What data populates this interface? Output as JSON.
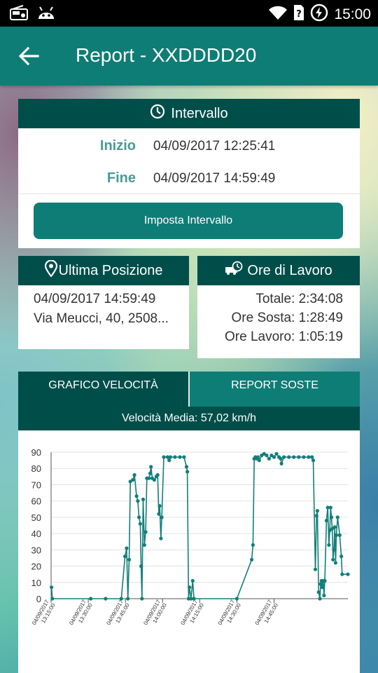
{
  "status_bar": {
    "time": "15:00",
    "icons": [
      "radio-icon",
      "android-icon",
      "wifi-icon",
      "sim-unknown-icon",
      "battery-charging-icon"
    ]
  },
  "app_bar": {
    "title": "Report - XXDDDD20",
    "back_icon": "arrow-back-icon"
  },
  "interval": {
    "header": "Intervallo",
    "header_icon": "clock-icon",
    "start_label": "Inizio",
    "start_value": "04/09/2017 12:25:41",
    "end_label": "Fine",
    "end_value": "04/09/2017 14:59:49",
    "button_label": "Imposta Intervallo"
  },
  "last_position": {
    "header": "Ultima Posizione",
    "header_icon": "map-pin-icon",
    "timestamp": "04/09/2017 14:59:49",
    "address": "Via Meucci, 40, 2508..."
  },
  "work_hours": {
    "header": "Ore di Lavoro",
    "header_icon": "truck-clock-icon",
    "total": "Totale: 2:34:08",
    "stop_hours": "Ore Sosta: 1:28:49",
    "work_hours": "Ore Lavoro: 1:05:19"
  },
  "tabs": [
    {
      "label": "GRAFICO VELOCITÀ",
      "active": true
    },
    {
      "label": "REPORT SOSTE",
      "active": false
    }
  ],
  "speed_summary": "Velocità Media: 57,02 km/h",
  "colors": {
    "primary": "#0e7d75",
    "primary_dark": "#004e4a",
    "label_teal": "#4a9a96",
    "line": "#137f79"
  },
  "chart_data": {
    "type": "line",
    "title": "",
    "xlabel": "",
    "ylabel": "",
    "ylim": [
      0,
      90
    ],
    "yticks": [
      0,
      10,
      20,
      30,
      40,
      50,
      60,
      70,
      80,
      90
    ],
    "xlim": [
      "13:00:00",
      "14:59:49"
    ],
    "xticks": [
      {
        "t": "13:00:00",
        "label": "04/09/2017 13:15:00"
      },
      {
        "t": "13:15:00",
        "label": "04/09/2017 13:30:00"
      },
      {
        "t": "13:30:00",
        "label": "04/09/2017 13:45:00"
      },
      {
        "t": "13:45:00",
        "label": "04/09/2017 14:00:00"
      },
      {
        "t": "14:00:00",
        "label": "04/09/2017 14:15:00"
      },
      {
        "t": "14:15:00",
        "label": "04/09/2017 14:30:00"
      },
      {
        "t": "14:30:00",
        "label": "04/09/2017 14:45:00"
      }
    ],
    "grid": true,
    "series": [
      {
        "points": [
          [
            "13:00:10",
            7
          ],
          [
            "13:00:30",
            0
          ],
          [
            "13:16:00",
            0
          ],
          [
            "13:22:00",
            0
          ],
          [
            "13:28:20",
            0
          ],
          [
            "13:29:50",
            26
          ],
          [
            "13:30:30",
            31
          ],
          [
            "13:31:00",
            0
          ],
          [
            "13:31:30",
            24
          ],
          [
            "13:32:00",
            72
          ],
          [
            "13:33:00",
            73
          ],
          [
            "13:33:40",
            76
          ],
          [
            "13:34:30",
            63
          ],
          [
            "13:35:00",
            60
          ],
          [
            "13:35:30",
            50
          ],
          [
            "13:36:00",
            46
          ],
          [
            "13:36:20",
            20
          ],
          [
            "13:36:40",
            0
          ],
          [
            "13:37:10",
            61
          ],
          [
            "13:37:40",
            33
          ],
          [
            "13:38:10",
            41
          ],
          [
            "13:38:40",
            74
          ],
          [
            "13:39:30",
            74
          ],
          [
            "13:40:00",
            77
          ],
          [
            "13:40:20",
            81
          ],
          [
            "13:40:50",
            74
          ],
          [
            "13:41:40",
            73
          ],
          [
            "13:42:30",
            75
          ],
          [
            "13:43:00",
            76
          ],
          [
            "13:43:30",
            52
          ],
          [
            "13:43:50",
            57
          ],
          [
            "13:44:20",
            37
          ],
          [
            "13:44:40",
            50
          ],
          [
            "13:45:30",
            87
          ],
          [
            "13:47:00",
            87
          ],
          [
            "13:47:40",
            85
          ],
          [
            "13:48:10",
            87
          ],
          [
            "13:50:00",
            87
          ],
          [
            "13:52:00",
            87
          ],
          [
            "13:53:40",
            87
          ],
          [
            "13:54:40",
            81
          ],
          [
            "13:55:00",
            78
          ],
          [
            "13:55:30",
            0
          ],
          [
            "13:55:50",
            7
          ],
          [
            "13:56:30",
            0
          ],
          [
            "13:57:10",
            11
          ],
          [
            "13:57:40",
            0
          ],
          [
            "14:15:00",
            0
          ],
          [
            "14:21:00",
            24
          ],
          [
            "14:21:30",
            33
          ],
          [
            "14:22:00",
            86
          ],
          [
            "14:22:30",
            87
          ],
          [
            "14:23:00",
            86
          ],
          [
            "14:23:30",
            87
          ],
          [
            "14:24:00",
            85
          ],
          [
            "14:25:00",
            88
          ],
          [
            "14:26:00",
            89
          ],
          [
            "14:27:00",
            88
          ],
          [
            "14:28:00",
            86
          ],
          [
            "14:29:00",
            88
          ],
          [
            "14:30:00",
            87
          ],
          [
            "14:31:00",
            89
          ],
          [
            "14:32:00",
            87
          ],
          [
            "14:32:40",
            86
          ],
          [
            "14:33:00",
            83
          ],
          [
            "14:34:00",
            87
          ],
          [
            "14:36:00",
            87
          ],
          [
            "14:38:00",
            87
          ],
          [
            "14:40:00",
            87
          ],
          [
            "14:42:00",
            87
          ],
          [
            "14:44:00",
            87
          ],
          [
            "14:45:20",
            87
          ],
          [
            "14:45:50",
            85
          ],
          [
            "14:46:40",
            18
          ],
          [
            "14:47:10",
            51
          ],
          [
            "14:47:30",
            54
          ],
          [
            "14:48:00",
            4
          ],
          [
            "14:48:30",
            0
          ],
          [
            "14:48:50",
            9
          ],
          [
            "14:49:10",
            11
          ],
          [
            "14:49:30",
            7
          ],
          [
            "14:49:50",
            11
          ],
          [
            "14:50:10",
            2
          ],
          [
            "14:50:30",
            11
          ],
          [
            "14:51:10",
            48
          ],
          [
            "14:51:40",
            56
          ],
          [
            "14:52:10",
            33
          ],
          [
            "14:52:30",
            42
          ],
          [
            "14:52:50",
            56
          ],
          [
            "14:53:10",
            50
          ],
          [
            "14:53:30",
            43
          ],
          [
            "14:53:50",
            24
          ],
          [
            "14:54:10",
            30
          ],
          [
            "14:54:30",
            44
          ],
          [
            "14:54:50",
            22
          ],
          [
            "14:55:10",
            39
          ],
          [
            "14:55:40",
            50
          ],
          [
            "14:56:30",
            39
          ],
          [
            "14:57:10",
            26
          ],
          [
            "14:57:30",
            15
          ],
          [
            "14:59:49",
            15
          ]
        ]
      }
    ]
  }
}
